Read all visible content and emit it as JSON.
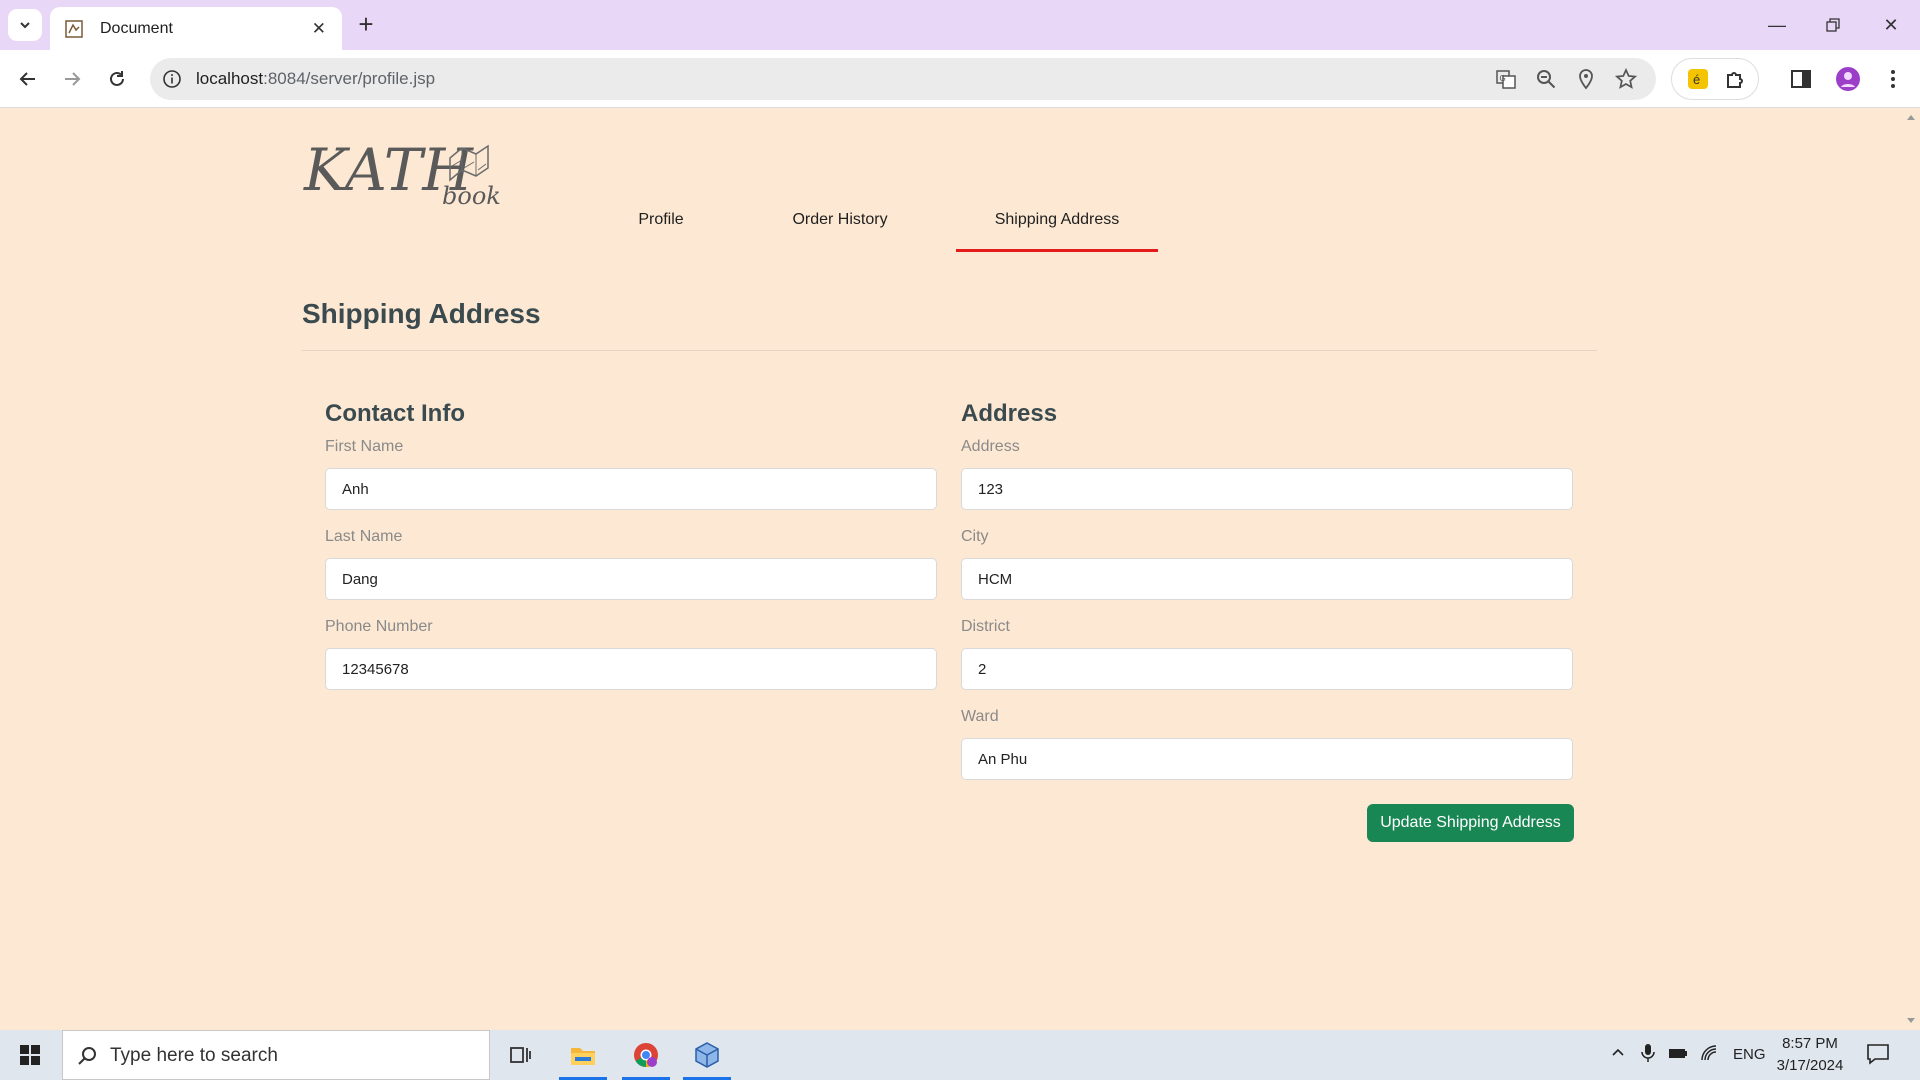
{
  "browser": {
    "tab_title": "Document",
    "url_host": "localhost",
    "url_path": ":8084/server/profile.jsp"
  },
  "nav": {
    "tabs": [
      {
        "label": "Profile",
        "active": false
      },
      {
        "label": "Order History",
        "active": false
      },
      {
        "label": "Shipping Address",
        "active": true
      }
    ]
  },
  "page": {
    "title": "Shipping Address"
  },
  "contact": {
    "heading": "Contact Info",
    "first_name_label": "First Name",
    "first_name_value": "Anh",
    "last_name_label": "Last Name",
    "last_name_value": "Dang",
    "phone_label": "Phone Number",
    "phone_value": "12345678"
  },
  "address": {
    "heading": "Address",
    "address_label": "Address",
    "address_value": "123",
    "city_label": "City",
    "city_value": "HCM",
    "district_label": "District",
    "district_value": "2",
    "ward_label": "Ward",
    "ward_value": "An Phu"
  },
  "actions": {
    "update_label": "Update Shipping Address"
  },
  "taskbar": {
    "search_placeholder": "Type here to search",
    "lang": "ENG",
    "time": "8:57 PM",
    "date": "3/17/2024"
  },
  "colors": {
    "page_bg": "#fde9d3",
    "active_tab_underline": "#e31b1b",
    "primary_button": "#198754",
    "heading": "#3b4a4f"
  }
}
